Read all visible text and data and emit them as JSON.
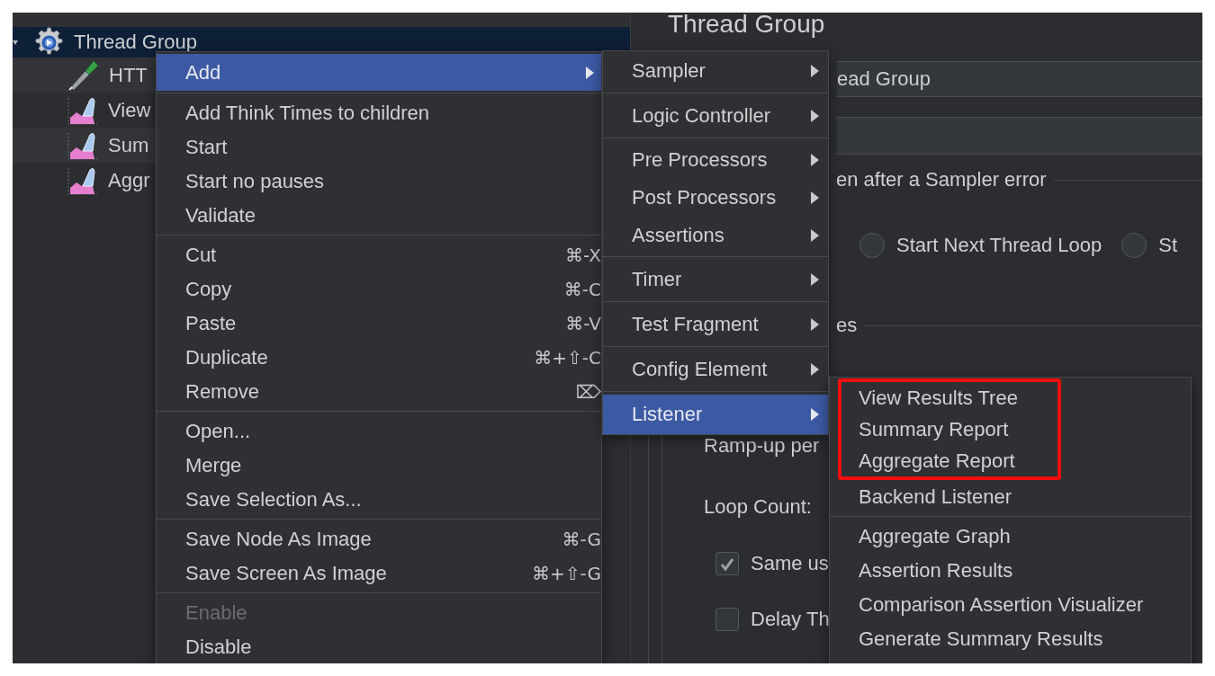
{
  "tree": {
    "root": {
      "label": "Thread Group",
      "selected": true,
      "expanded": true,
      "children": [
        {
          "label": "HTT",
          "kind": "sampler"
        },
        {
          "label": "View",
          "kind": "listener"
        },
        {
          "label": "Sum",
          "kind": "listener"
        },
        {
          "label": "Aggr",
          "kind": "listener"
        }
      ]
    }
  },
  "panel": {
    "title": "Thread Group",
    "name_field": {
      "value": "ead Group"
    },
    "error_group": {
      "legend": "en after a Sampler error",
      "options": [
        {
          "label": "Start Next Thread Loop",
          "selected": false
        },
        {
          "label": "St",
          "selected": false
        }
      ]
    },
    "thread_properties": {
      "legend": "es",
      "ramp_up_label": "Ramp-up per",
      "loop_count_label": "Loop Count:",
      "checkboxes": [
        {
          "label": "Same us",
          "checked": true
        },
        {
          "label": "Delay Th",
          "checked": false
        }
      ]
    }
  },
  "context_menu": {
    "groups": [
      [
        {
          "label": "Add",
          "selected": true,
          "disabled": false,
          "submenu": true
        }
      ],
      [
        {
          "label": "Add Think Times to children",
          "selected": false,
          "disabled": false
        },
        {
          "label": "Start",
          "selected": false,
          "disabled": false
        },
        {
          "label": "Start no pauses",
          "selected": false,
          "disabled": false
        },
        {
          "label": "Validate",
          "selected": false,
          "disabled": false
        }
      ],
      [
        {
          "label": "Cut",
          "shortcut": "⌘-X",
          "selected": false,
          "disabled": false
        },
        {
          "label": "Copy",
          "shortcut": "⌘-C",
          "selected": false,
          "disabled": false
        },
        {
          "label": "Paste",
          "shortcut": "⌘-V",
          "selected": false,
          "disabled": false
        },
        {
          "label": "Duplicate",
          "shortcut": "⌘+⇧-C",
          "selected": false,
          "disabled": false
        },
        {
          "label": "Remove",
          "shortcut": "⌦",
          "selected": false,
          "disabled": false
        }
      ],
      [
        {
          "label": "Open...",
          "selected": false,
          "disabled": false
        },
        {
          "label": "Merge",
          "selected": false,
          "disabled": false
        },
        {
          "label": "Save Selection As...",
          "selected": false,
          "disabled": false
        }
      ],
      [
        {
          "label": "Save Node As Image",
          "shortcut": "⌘-G",
          "selected": false,
          "disabled": false
        },
        {
          "label": "Save Screen As Image",
          "shortcut": "⌘+⇧-G",
          "selected": false,
          "disabled": false
        }
      ],
      [
        {
          "label": "Enable",
          "selected": false,
          "disabled": true
        },
        {
          "label": "Disable",
          "selected": false,
          "disabled": false
        }
      ]
    ]
  },
  "add_submenu": {
    "groups": [
      [
        {
          "label": "Sampler",
          "selected": false,
          "submenu": true
        }
      ],
      [
        {
          "label": "Logic Controller",
          "selected": false,
          "submenu": true
        }
      ],
      [
        {
          "label": "Pre Processors",
          "selected": false,
          "submenu": true
        },
        {
          "label": "Post Processors",
          "selected": false,
          "submenu": true
        },
        {
          "label": "Assertions",
          "selected": false,
          "submenu": true
        }
      ],
      [
        {
          "label": "Timer",
          "selected": false,
          "submenu": true
        }
      ],
      [
        {
          "label": "Test Fragment",
          "selected": false,
          "submenu": true
        }
      ],
      [
        {
          "label": "Config Element",
          "selected": false,
          "submenu": true
        }
      ],
      [
        {
          "label": "Listener",
          "selected": true,
          "submenu": true
        }
      ]
    ]
  },
  "listener_submenu": {
    "groups": [
      [
        {
          "label": "View Results Tree",
          "selected": false,
          "annotated": true
        },
        {
          "label": "Summary Report",
          "selected": false,
          "annotated": true
        },
        {
          "label": "Aggregate Report",
          "selected": false,
          "annotated": true
        },
        {
          "label": "Backend Listener",
          "selected": false,
          "annotated": false
        }
      ],
      [
        {
          "label": "Aggregate Graph",
          "selected": false,
          "annotated": false
        },
        {
          "label": "Assertion Results",
          "selected": false,
          "annotated": false
        },
        {
          "label": "Comparison Assertion Visualizer",
          "selected": false,
          "annotated": false
        },
        {
          "label": "Generate Summary Results",
          "selected": false,
          "annotated": false
        }
      ]
    ]
  }
}
